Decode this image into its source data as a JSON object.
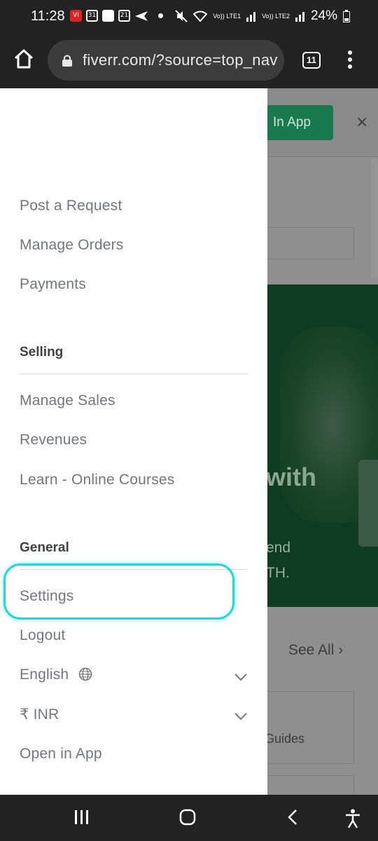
{
  "status_bar": {
    "time": "11:28",
    "battery": "24%",
    "notif_icons": [
      "vi-icon",
      "calendar-31-icon",
      "document-icon",
      "calendar-21-icon",
      "send-icon"
    ],
    "calendar_day_a": "31",
    "calendar_day_b": "21",
    "vi_label": "VI",
    "lte1": "Vo)) LTE1",
    "lte2": "Vo)) LTE2"
  },
  "browser": {
    "url": "fiverr.com/?source=top_nav",
    "tab_count": "11"
  },
  "background_page": {
    "open_app_label": "In App",
    "close_label": "×",
    "hero_word": "with",
    "hero_line2": "end",
    "hero_line3": "TH.",
    "see_all": "See All ›",
    "card_text": "Guides",
    "accent_color": "#1dbf73"
  },
  "drawer": {
    "buying_items": [
      {
        "label": "Post a Request"
      },
      {
        "label": "Manage Orders"
      },
      {
        "label": "Payments"
      }
    ],
    "selling_title": "Selling",
    "selling_items": [
      {
        "label": "Manage Sales"
      },
      {
        "label": "Revenues"
      },
      {
        "label": "Learn - Online Courses"
      }
    ],
    "general_title": "General",
    "general_items": {
      "settings": "Settings",
      "logout": "Logout",
      "language": "English",
      "currency": "₹ INR",
      "open_in_app": "Open in App"
    },
    "highlight_color": "#22d6e0"
  }
}
